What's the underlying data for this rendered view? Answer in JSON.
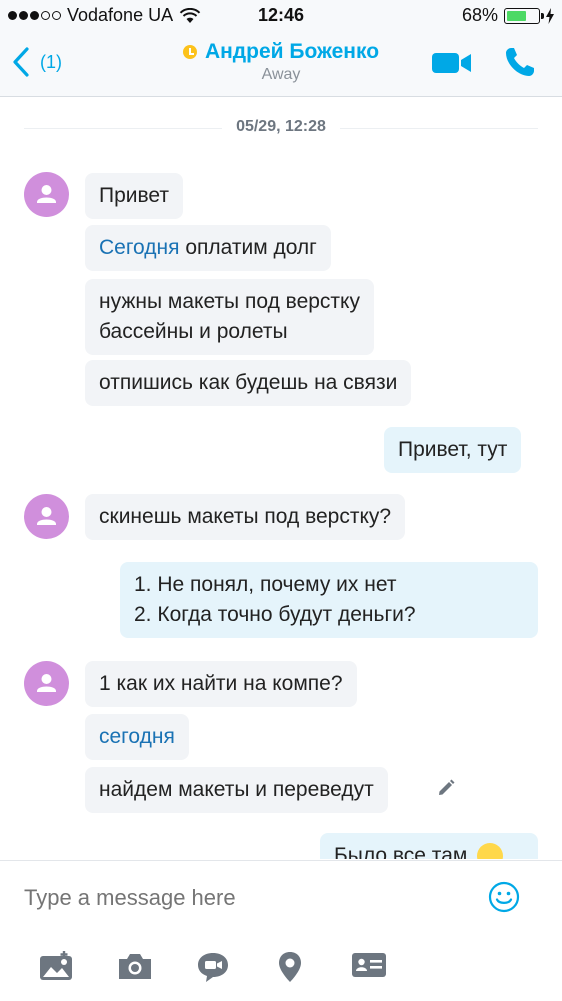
{
  "status_bar": {
    "carrier": "Vodafone UA",
    "time": "12:46",
    "battery_percent": "68%",
    "battery_level": 0.68,
    "signal_bars_filled": 3,
    "signal_bars_total": 5
  },
  "header": {
    "back_count": "(1)",
    "contact_name": "Андрей Боженко",
    "contact_status": "Away",
    "presence_color": "#fcc21b",
    "accent_color": "#00a8e6"
  },
  "chat": {
    "date_separator": "05/29, 12:28",
    "messages": [
      {
        "text": "Привет"
      },
      {
        "link": "Сегодня",
        "text": " оплатим долг"
      },
      {
        "line1": "нужны макеты под верстку",
        "line2": "бассейны и ролеты"
      },
      {
        "text": "отпишись как будешь на связи"
      },
      {
        "text": "Привет, тут"
      },
      {
        "text": "скинешь макеты под верстку?"
      },
      {
        "line1": "1. Не понял, почему их нет",
        "line2": "2. Когда точно будут деньги?"
      },
      {
        "text": "1 как их найти на компе?"
      },
      {
        "link": "сегодня"
      },
      {
        "text": "найдем макеты и переведут"
      },
      {
        "text": "Было все там"
      }
    ]
  },
  "composer": {
    "placeholder": "Type a message here"
  },
  "icons": {
    "back": "chevron-left-icon",
    "video": "video-camera-icon",
    "call": "phone-icon",
    "edit": "pencil-icon",
    "emoji": "emoji-icon",
    "toolbar": [
      "image-icon",
      "camera-icon",
      "video-message-icon",
      "location-icon",
      "contact-card-icon"
    ]
  }
}
